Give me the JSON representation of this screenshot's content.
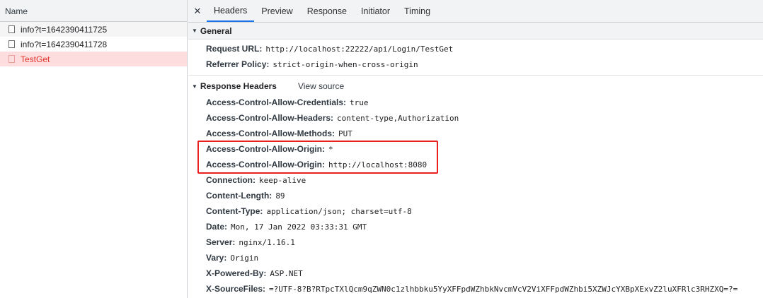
{
  "request_list": {
    "header": "Name",
    "items": [
      {
        "name": "info?t=1642390411725"
      },
      {
        "name": "info?t=1642390411728"
      },
      {
        "name": "TestGet"
      }
    ]
  },
  "tabs": {
    "close": "✕",
    "items": [
      "Headers",
      "Preview",
      "Response",
      "Initiator",
      "Timing"
    ],
    "active": "Headers"
  },
  "general": {
    "title": "General",
    "rows": [
      {
        "key": "Request URL:",
        "value": "http://localhost:22222/api/Login/TestGet"
      },
      {
        "key": "Referrer Policy:",
        "value": "strict-origin-when-cross-origin"
      }
    ]
  },
  "response_headers": {
    "title": "Response Headers",
    "view_source": "View source",
    "rows": [
      {
        "key": "Access-Control-Allow-Credentials:",
        "value": "true"
      },
      {
        "key": "Access-Control-Allow-Headers:",
        "value": "content-type,Authorization"
      },
      {
        "key": "Access-Control-Allow-Methods:",
        "value": "PUT"
      },
      {
        "key": "Access-Control-Allow-Origin:",
        "value": "*"
      },
      {
        "key": "Access-Control-Allow-Origin:",
        "value": "http://localhost:8080"
      },
      {
        "key": "Connection:",
        "value": "keep-alive"
      },
      {
        "key": "Content-Length:",
        "value": "89"
      },
      {
        "key": "Content-Type:",
        "value": "application/json; charset=utf-8"
      },
      {
        "key": "Date:",
        "value": "Mon, 17 Jan 2022 03:33:31 GMT"
      },
      {
        "key": "Server:",
        "value": "nginx/1.16.1"
      },
      {
        "key": "Vary:",
        "value": "Origin"
      },
      {
        "key": "X-Powered-By:",
        "value": "ASP.NET"
      },
      {
        "key": "X-SourceFiles:",
        "value": "=?UTF-8?B?RTpcTXlQcm9qZWN0c1zlhbbku5YyXFFpdWZhbkNvcmVcV2ViXFFpdWZhbi5XZWJcYXBpXExvZ2luXFRlc3RHZXQ=?="
      }
    ]
  },
  "colors": {
    "selected_row_bg": "#fddddd",
    "selected_row_text": "#e3352c",
    "highlight_box": "#e8201e",
    "active_tab_underline": "#1a73e8"
  }
}
